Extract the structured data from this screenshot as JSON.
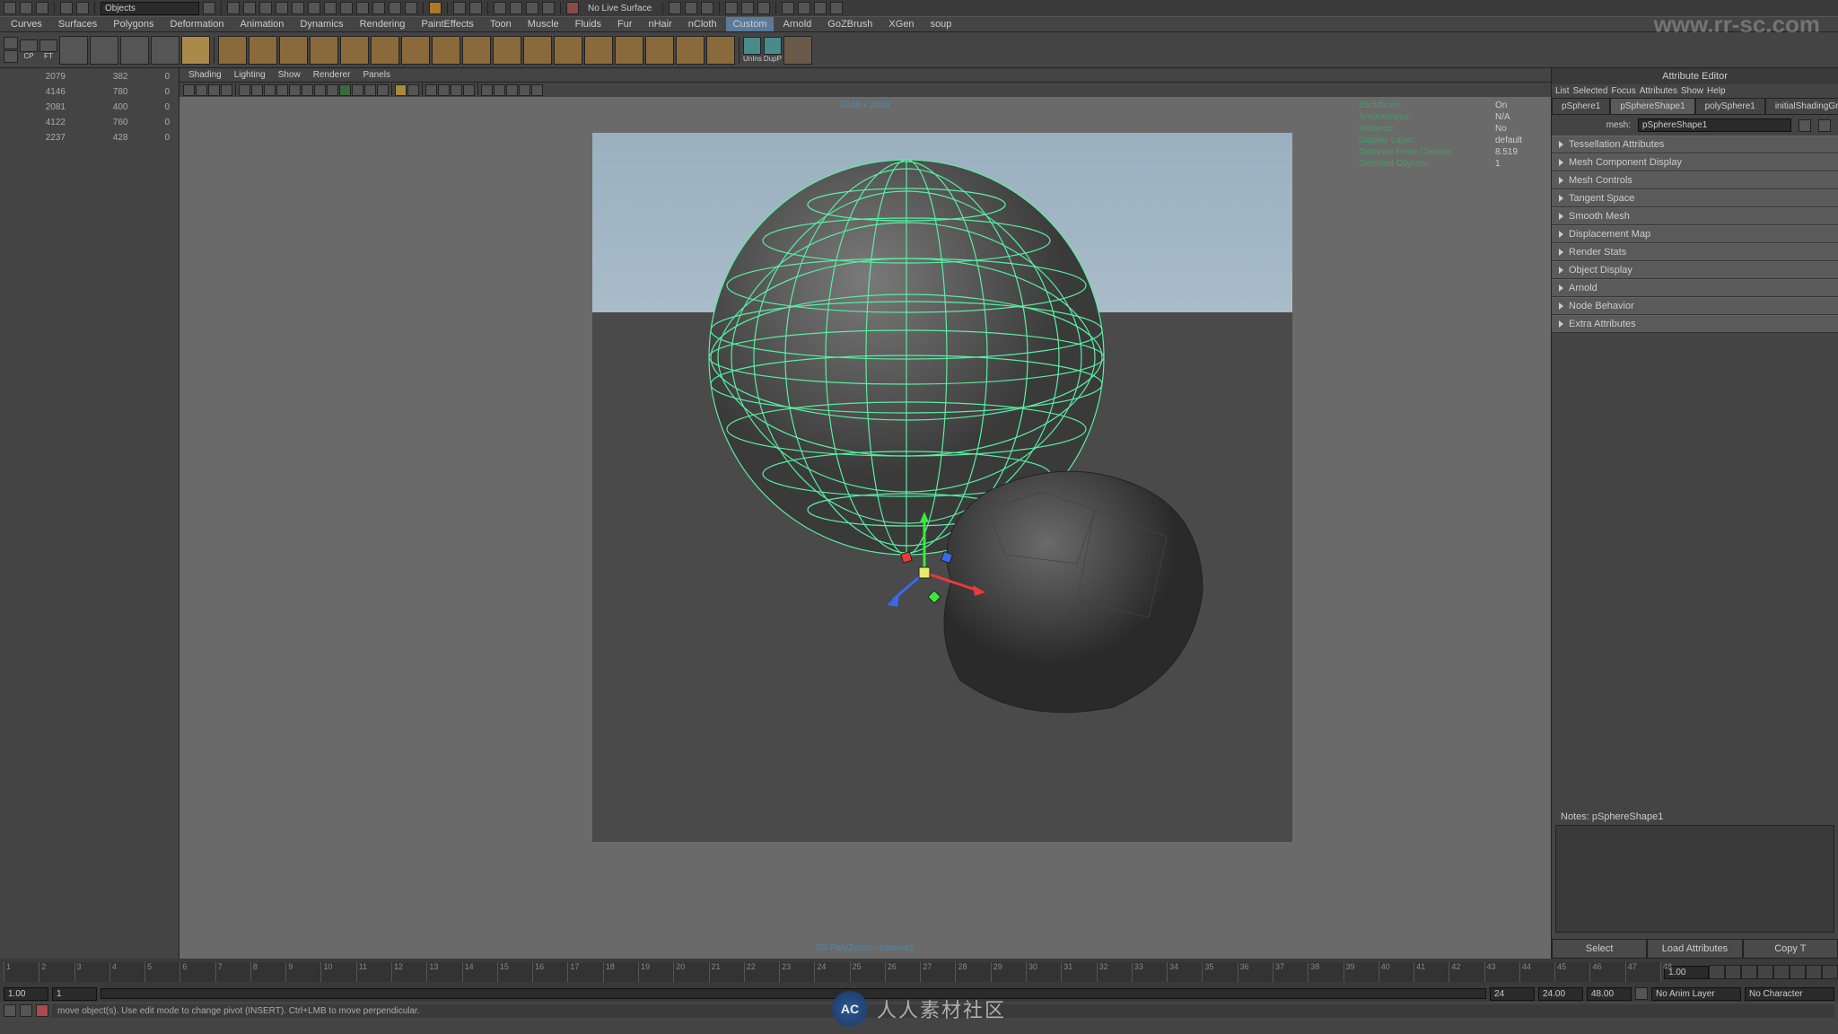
{
  "topbar": {
    "search_field": "Objects",
    "live_surface": "No Live Surface"
  },
  "menus": [
    "Curves",
    "Surfaces",
    "Polygons",
    "Deformation",
    "Animation",
    "Dynamics",
    "Rendering",
    "PaintEffects",
    "Toon",
    "Muscle",
    "Fluids",
    "Fur",
    "nHair",
    "nCloth",
    "Custom",
    "Arnold",
    "GoZBrush",
    "XGen",
    "soup"
  ],
  "shelf_labels": {
    "unins": "UnIns",
    "dupp": "DupP"
  },
  "outliner_stats": [
    {
      "a": "2079",
      "b": "382",
      "c": "0"
    },
    {
      "a": "4146",
      "b": "780",
      "c": "0"
    },
    {
      "a": "2081",
      "b": "400",
      "c": "0"
    },
    {
      "a": "4122",
      "b": "760",
      "c": "0"
    },
    {
      "a": "2237",
      "b": "428",
      "c": "0"
    }
  ],
  "viewport_menus": [
    "Shading",
    "Lighting",
    "Show",
    "Renderer",
    "Panels"
  ],
  "viewport": {
    "title": "2048 x 2048",
    "camera": "2D Pan/Zoom - camera1"
  },
  "hud": [
    {
      "label": "Backfaces:",
      "value": "On"
    },
    {
      "label": "Smoothness:",
      "value": "N/A"
    },
    {
      "label": "Instance:",
      "value": "No"
    },
    {
      "label": "Display Layer:",
      "value": "default"
    },
    {
      "label": "Distance From Camera:",
      "value": "8.519"
    },
    {
      "label": "Selected Objects:",
      "value": "1"
    }
  ],
  "attribute_editor": {
    "title": "Attribute Editor",
    "menus": [
      "List",
      "Selected",
      "Focus",
      "Attributes",
      "Show",
      "Help"
    ],
    "tabs": [
      "pSphere1",
      "pSphereShape1",
      "polySphere1",
      "initialShadingGroup"
    ],
    "active_tab": 1,
    "mesh_label": "mesh:",
    "mesh_value": "pSphereShape1",
    "sections": [
      "Tessellation Attributes",
      "Mesh Component Display",
      "Mesh Controls",
      "Tangent Space",
      "Smooth Mesh",
      "Displacement Map",
      "Render Stats",
      "Object Display",
      "Arnold",
      "Node Behavior",
      "Extra Attributes"
    ],
    "notes_label": "Notes: pSphereShape1",
    "buttons": [
      "Select",
      "Load Attributes",
      "Copy T"
    ]
  },
  "timeline": {
    "start": 1,
    "end": 48
  },
  "range": {
    "min": "1.00",
    "start": "1",
    "end": "24",
    "max": "1.00",
    "fps": "24.00",
    "current": "48.00",
    "anim_layer": "No Anim Layer",
    "char": "No Character"
  },
  "status": {
    "msg": "move object(s). Use edit mode to change pivot (INSERT). Ctrl+LMB to move perpendicular."
  },
  "watermark": {
    "logo": "AC",
    "text": "人人素材社区",
    "url": "www.rr-sc.com"
  }
}
